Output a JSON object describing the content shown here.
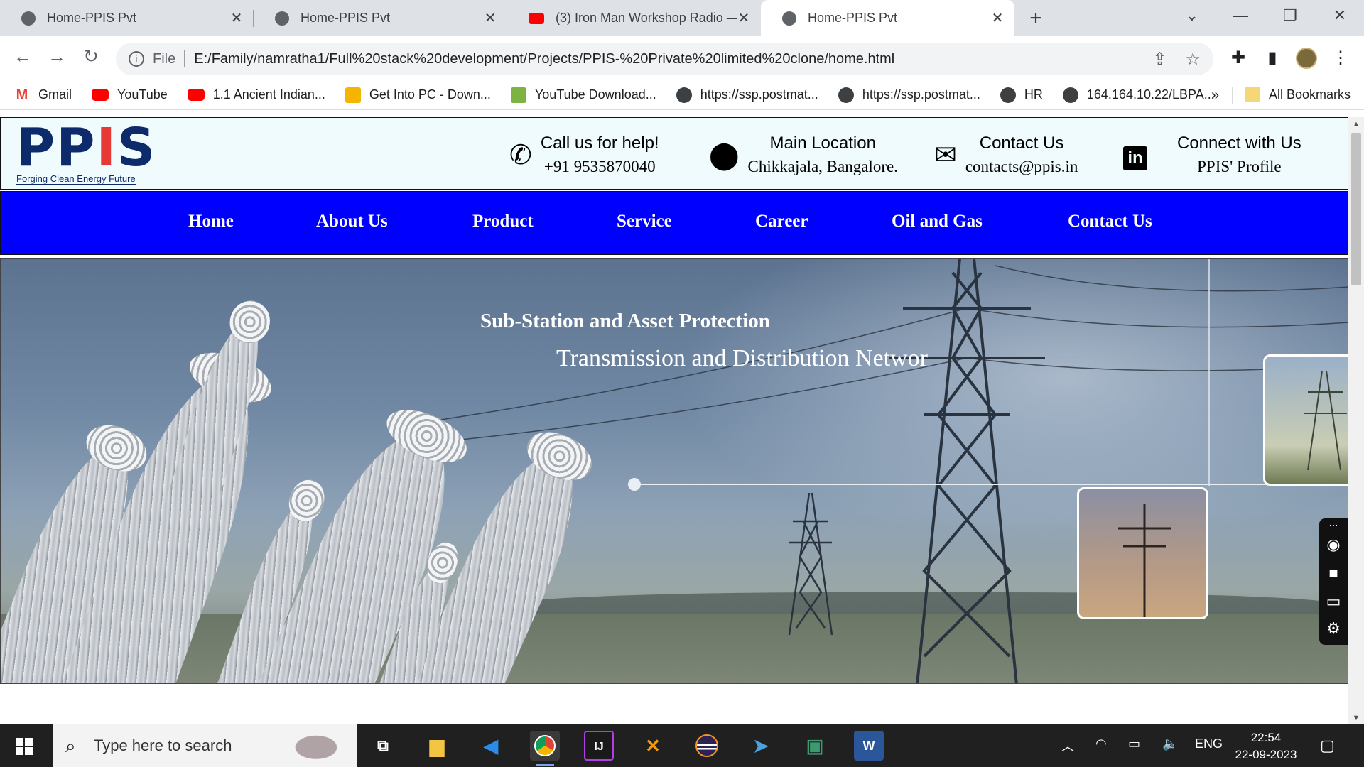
{
  "browser": {
    "tabs": [
      {
        "title": "Home-PPIS Pvt",
        "favicon": "globe-icon",
        "active": false
      },
      {
        "title": "Home-PPIS Pvt",
        "favicon": "globe-icon",
        "active": false
      },
      {
        "title": "(3) Iron Man Workshop Radio —",
        "favicon": "youtube-icon",
        "active": false
      },
      {
        "title": "Home-PPIS Pvt",
        "favicon": "globe-icon",
        "active": true
      }
    ],
    "close_glyph": "✕",
    "new_tab_glyph": "+",
    "window_controls": {
      "tab_search": "⌄",
      "minimize": "—",
      "restore": "❐",
      "close": "✕"
    },
    "address": {
      "scheme_label": "File",
      "url": "E:/Family/namratha1/Full%20stack%20development/Projects/PPIS-%20Private%20limited%20clone/home.html"
    },
    "nav": {
      "back": "←",
      "forward": "→",
      "reload": "↻"
    },
    "bookmarks": [
      {
        "label": "Gmail",
        "icon": "gmail-icon"
      },
      {
        "label": "YouTube",
        "icon": "youtube-icon"
      },
      {
        "label": "1.1 Ancient Indian...",
        "icon": "youtube-icon"
      },
      {
        "label": "Get Into PC - Down...",
        "icon": "getintopc-icon"
      },
      {
        "label": "YouTube Download...",
        "icon": "download-icon"
      },
      {
        "label": "https://ssp.postmat...",
        "icon": "globe-icon"
      },
      {
        "label": "https://ssp.postmat...",
        "icon": "globe-icon"
      },
      {
        "label": "HR",
        "icon": "globe-icon"
      },
      {
        "label": "164.164.10.22/LBPA...",
        "icon": "globe-icon"
      }
    ],
    "bookmarks_overflow": "»",
    "all_bookmarks": "All Bookmarks"
  },
  "site": {
    "logo": {
      "text_pp": "PP",
      "text_i": "I",
      "text_s": "S",
      "tagline": "Forging Clean Energy Future"
    },
    "header_info": [
      {
        "icon": "phone-icon",
        "line1": "Call us for help!",
        "line2": "+91 9535870040"
      },
      {
        "icon": "location-pin-icon",
        "line1": "Main Location",
        "line2": "Chikkajala, Bangalore."
      },
      {
        "icon": "mail-icon",
        "line1": "Contact Us",
        "line2": "contacts@ppis.in"
      },
      {
        "icon": "linkedin-icon",
        "line1": "Connect with Us",
        "line2": "PPIS' Profile"
      }
    ],
    "linkedin_glyph": "in",
    "nav": [
      "Home",
      "About Us",
      "Product",
      "Service",
      "Career",
      "Oil and Gas",
      "Contact Us"
    ],
    "hero": {
      "heading": "Sub-Station and Asset Protection",
      "subheading": "Transmission and Distribution Networ"
    }
  },
  "taskbar": {
    "search_placeholder": "Type here to search",
    "apps": [
      "task-view-icon",
      "file-explorer-icon",
      "vscode-icon",
      "chrome-icon",
      "intellij-icon",
      "xampp-icon",
      "eclipse-icon",
      "mysql-workbench-icon",
      "sublime-icon",
      "word-icon"
    ],
    "tray_language": "ENG",
    "time": "22:54",
    "date": "22-09-2023"
  },
  "colors": {
    "nav_bg": "#0000ff",
    "header_bg": "#effbfd",
    "logo_blue": "#0d2b6b",
    "logo_accent": "#e53935"
  }
}
